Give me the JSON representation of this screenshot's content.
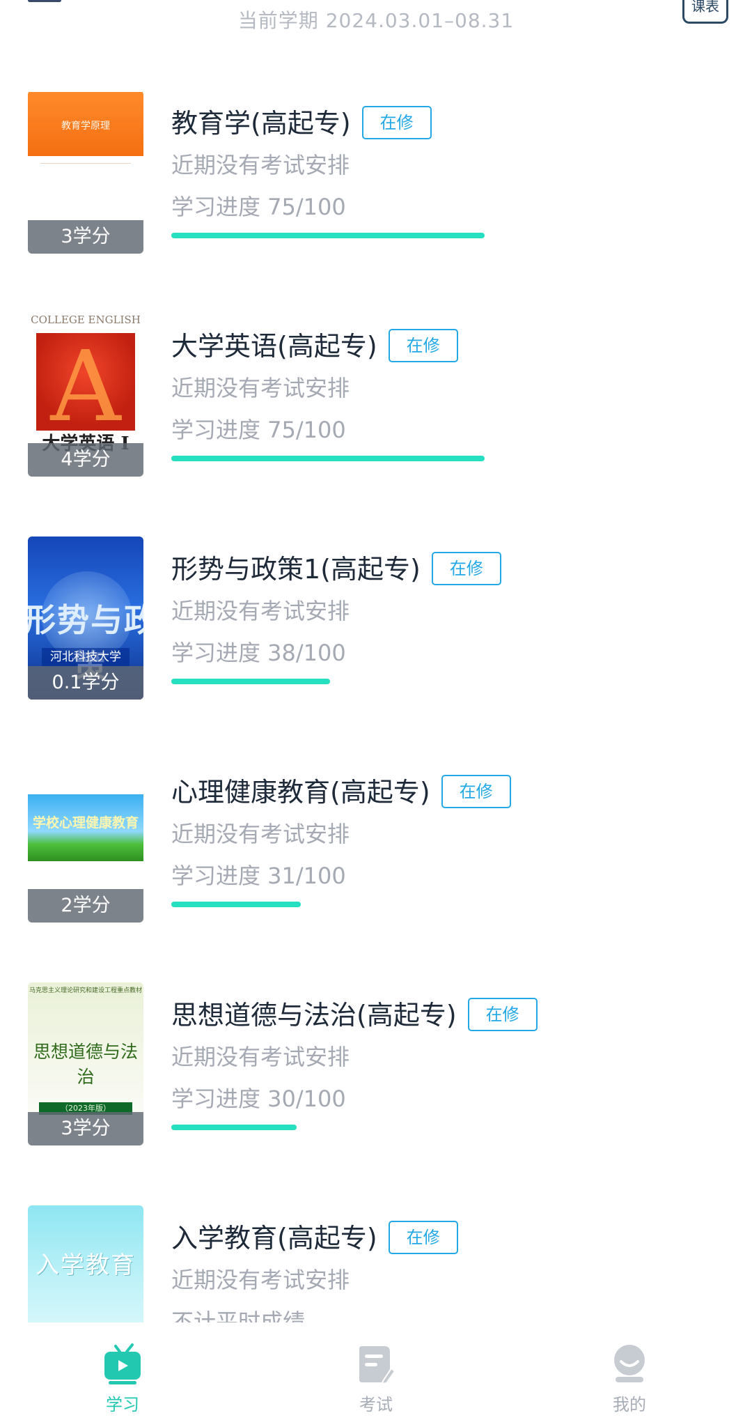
{
  "header": {
    "semester": "当前学期 2024.03.01–08.31",
    "timetable_label": "课表"
  },
  "colors": {
    "accent": "#22c8b0",
    "progress": "#26dfc1",
    "tag_border": "#22a8e6",
    "title": "#1e2a3a",
    "muted": "#a4a9b3"
  },
  "courses": [
    {
      "name": "教育学(高起专)",
      "status": "在修",
      "exam": "近期没有考试安排",
      "progress_text": "学习进度 75/100",
      "progress": 0.75,
      "credit": "3学分",
      "cover_title": "教育学原理"
    },
    {
      "name": "大学英语(高起专)",
      "status": "在修",
      "exam": "近期没有考试安排",
      "progress_text": "学习进度 75/100",
      "progress": 0.75,
      "credit": "4学分",
      "cover_title": "COLLEGE ENGLISH",
      "cover_subtitle": "大学英语 I",
      "cover_letter": "A"
    },
    {
      "name": "形势与政策1(高起专)",
      "status": "在修",
      "exam": "近期没有考试安排",
      "progress_text": "学习进度 38/100",
      "progress": 0.38,
      "credit": "0.1学分",
      "cover_title": "形势与政策",
      "cover_subtitle": "河北科技大学"
    },
    {
      "name": "心理健康教育(高起专)",
      "status": "在修",
      "exam": "近期没有考试安排",
      "progress_text": "学习进度 31/100",
      "progress": 0.31,
      "credit": "2学分",
      "cover_title": "学校心理健康教育"
    },
    {
      "name": "思想道德与法治(高起专)",
      "status": "在修",
      "exam": "近期没有考试安排",
      "progress_text": "学习进度 30/100",
      "progress": 0.3,
      "credit": "3学分",
      "cover_top": "马克思主义理论研究和建设工程重点教材",
      "cover_title": "思想道德与法治",
      "cover_subtitle": "（2023年版）"
    },
    {
      "name": "入学教育(高起专)",
      "status": "在修",
      "exam": "近期没有考试安排",
      "progress_text": "不计平时成绩",
      "progress": null,
      "credit": "",
      "cover_title": "入学教育"
    }
  ],
  "tabbar": {
    "items": [
      {
        "label": "学习",
        "icon": "tv-play-icon",
        "active": true
      },
      {
        "label": "考试",
        "icon": "exam-paper-icon",
        "active": false
      },
      {
        "label": "我的",
        "icon": "profile-icon",
        "active": false
      }
    ]
  }
}
